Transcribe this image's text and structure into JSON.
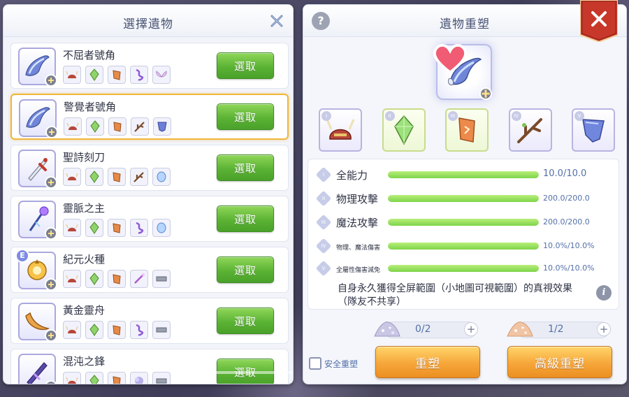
{
  "left": {
    "title": "選擇遺物",
    "pick_label": "選取",
    "items": [
      {
        "name": "不屈者號角",
        "icon": "horn-icon",
        "mats": [
          "helm",
          "crystal",
          "stone",
          "helix",
          "wings"
        ]
      },
      {
        "name": "警覺者號角",
        "icon": "horn-icon",
        "mats": [
          "helm",
          "crystal",
          "stone",
          "branch",
          "shield"
        ],
        "selected": true
      },
      {
        "name": "聖詩刻刀",
        "icon": "dagger-icon",
        "mats": [
          "helm",
          "crystal",
          "stone",
          "branch",
          "gem"
        ]
      },
      {
        "name": "靈脈之主",
        "icon": "staff-icon",
        "mats": [
          "helm",
          "crystal",
          "stone",
          "helix",
          "gem"
        ]
      },
      {
        "name": "紀元火種",
        "icon": "orb-icon",
        "mats": [
          "helm",
          "crystal",
          "stone",
          "wand",
          "bar"
        ],
        "badge": "E"
      },
      {
        "name": "黃金靈舟",
        "icon": "boat-icon",
        "mats": [
          "helm",
          "crystal",
          "stone",
          "helix",
          "bar"
        ]
      },
      {
        "name": "混沌之鋒",
        "icon": "blade-icon",
        "mats": [
          "helm",
          "crystal",
          "stone",
          "mist",
          "bar"
        ]
      }
    ]
  },
  "right": {
    "title": "遺物重塑",
    "help": "?",
    "slots": [
      {
        "num": "I",
        "icon": "helmet-icon",
        "green": false
      },
      {
        "num": "II",
        "icon": "crystal-icon",
        "green": true
      },
      {
        "num": "III",
        "icon": "rune-stone-icon",
        "green": true
      },
      {
        "num": "IV",
        "icon": "branch-icon",
        "green": false
      },
      {
        "num": "V",
        "icon": "shard-icon",
        "green": false
      }
    ],
    "stats": [
      {
        "num": "I",
        "label": "全能力",
        "value": "10.0/10.0",
        "fill": 1.0
      },
      {
        "num": "II",
        "label": "物理攻擊",
        "value": "200.0/200.0",
        "fill": 1.0
      },
      {
        "num": "III",
        "label": "魔法攻擊",
        "value": "200.0/200.0",
        "fill": 1.0
      },
      {
        "num": "IV",
        "label": "物理、魔法傷害",
        "value": "10.0%/10.0%",
        "fill": 1.0
      },
      {
        "num": "V",
        "label": "全屬性傷害減免",
        "value": "10.0%/10.0%",
        "fill": 1.0
      }
    ],
    "description": "自身永久獲得全屏範圍（小地圖可視範圍）的真視效果（隊友不共享）",
    "info": "i",
    "cost1": "0/2",
    "cost2": "1/2",
    "plus": "+",
    "safe_label": "安全重塑",
    "reforge_label": "重塑",
    "adv_reforge_label": "高級重塑"
  },
  "colors": {
    "accent_green": "#5bb334",
    "accent_orange": "#f6a63a",
    "selected_border": "#f0b63a",
    "close_red": "#c8382a"
  }
}
